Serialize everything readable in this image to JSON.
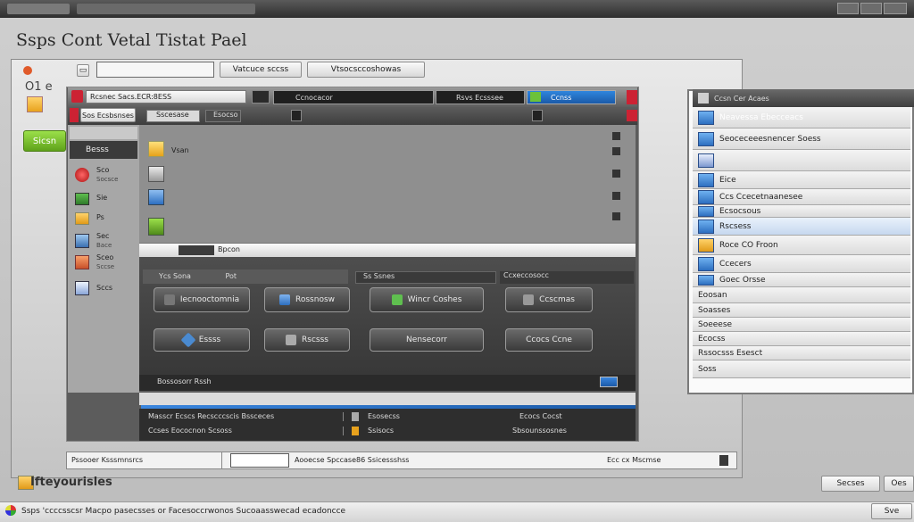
{
  "topbar": {
    "title": "",
    "controls": [
      "minimize",
      "maximize",
      "close"
    ]
  },
  "page_title": "Ssps Cont Vetal Tistat Pael",
  "toolbar": {
    "input_value": "",
    "button1": "Vatcuce sccss",
    "button2": "Vtsocsccoshowas"
  },
  "left_small": {
    "label": "O1 e"
  },
  "green_button": {
    "label": "Sicsn"
  },
  "dialog": {
    "title": "Rcsnec Sacs.ECR:8ESS",
    "tab_center": "Ccnocacor",
    "tab_right1": "Rsvs Ecsssee",
    "tab_right2": "Ccnss",
    "secondbar": {
      "b1": "Sos Ecsbsnses",
      "b2": "Sscesase",
      "b3": "Esocso"
    },
    "sidebar": {
      "header": "Besss",
      "items": [
        {
          "label": "Sco",
          "sub": "Socsce",
          "icon": "power-icon"
        },
        {
          "label": "Sie",
          "sub": "",
          "icon": "monitor-icon"
        },
        {
          "label": "Ps",
          "sub": "",
          "icon": "folder-icon"
        },
        {
          "label": "Sec",
          "sub": "Bace",
          "icon": "grid-icon"
        },
        {
          "label": "Sceo",
          "sub": "Sccse",
          "icon": "warning-icon"
        },
        {
          "label": "Sccs",
          "sub": "",
          "icon": "window-icon"
        }
      ]
    },
    "icon_list": [
      {
        "label": "Vsan"
      },
      {
        "label": ""
      },
      {
        "label": ""
      },
      {
        "label": ""
      }
    ],
    "section_label": "Bpcon",
    "panel": {
      "tab1": "Ycs Sona",
      "tab2": "Pot",
      "tab3": "Ss Ssnes",
      "tab4": "Ccxeccosocc",
      "buttons": [
        "Iecnooctomnia",
        "Rossnosw",
        "Wincr Coshes",
        "Ccscmas",
        "Essss",
        "Rscsss",
        "Nensecorr",
        "Ccocs Ccne"
      ],
      "footer": "Bossosorr Rssh"
    },
    "table": {
      "rows": [
        {
          "c1": "Masscr Ecscs Recscccscis Bssceces",
          "c2": "Esosecss",
          "c3": "Ecocs Cocst"
        },
        {
          "c1": "Ccses Eococnon Scsoss",
          "c2": "Ssisocs",
          "c3": "Sbsounssosnes"
        }
      ]
    }
  },
  "statusbar_mid": {
    "left": "Pssooer Ksssmnsrcs",
    "center": "Aooecse Spccase86 Ssicessshss",
    "right": "Ecc cx Mscmse"
  },
  "bottom_logo": {
    "label": "Ifteyourisles"
  },
  "bottom_buttons": {
    "b1": "Secses",
    "b2": "Oes"
  },
  "bottom_status": {
    "text": "Ssps 'ccccsscsr Macpo pasecsses or Facesoccrwonos Sucoaasswecad ecadoncce",
    "right": "Sve"
  },
  "right_panel": {
    "title": "Ccsn Cer Acaes",
    "rows": [
      {
        "label": "Neavessa Ebecceacs",
        "active": true
      },
      {
        "label": "Seoceceeesnencer Soess",
        "active": false
      },
      {
        "label": "",
        "active": false
      },
      {
        "label": "Eice",
        "active": false
      },
      {
        "label": "Ccs Ccecetnaanesee",
        "active": false
      },
      {
        "label": "Ecsocsous",
        "active": false
      },
      {
        "label": "Rscsess",
        "active": true
      },
      {
        "label": "Roce CO Froon",
        "active": false
      },
      {
        "label": "Ccecers",
        "active": false
      },
      {
        "label": "Goec Orsse",
        "active": false
      },
      {
        "label": "Eoosan",
        "active": false
      },
      {
        "label": "Soasses",
        "active": false
      },
      {
        "label": "Soeeese",
        "active": false
      },
      {
        "label": "Ecocss",
        "active": false
      },
      {
        "label": "Rssocsss Esesct",
        "active": false
      },
      {
        "label": "Soss",
        "active": false
      }
    ]
  },
  "colors": {
    "accent": "#2f79cf",
    "green": "#7cc22a",
    "dark": "#3c3c3c",
    "red": "#c23"
  }
}
